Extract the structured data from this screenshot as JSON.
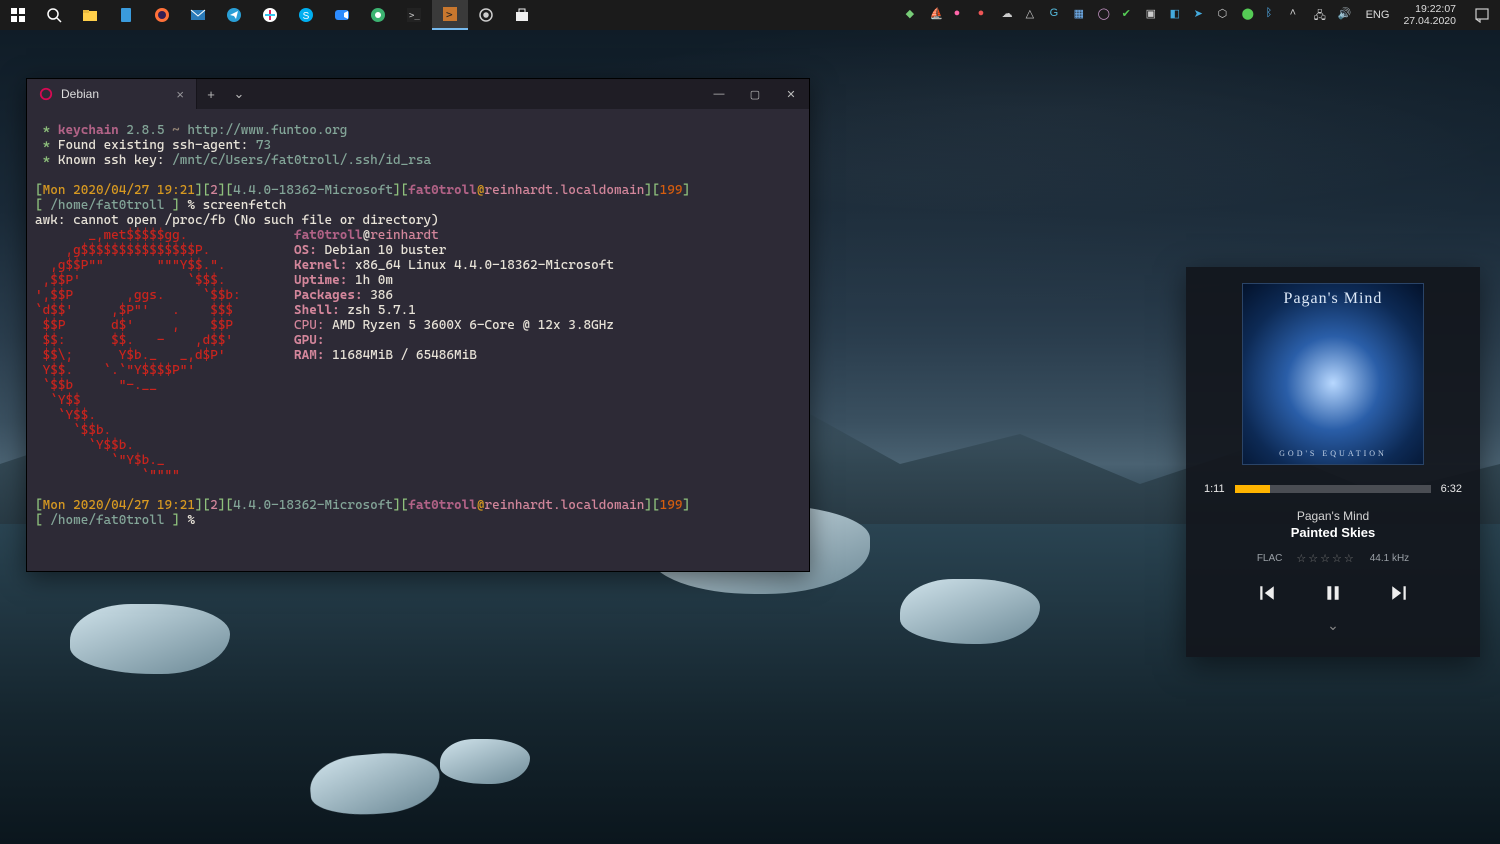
{
  "taskbar": {
    "lang": "ENG",
    "time": "19:22:07",
    "date": "27.04.2020"
  },
  "terminal": {
    "tab_title": "Debian",
    "keychain": {
      "name": "keychain",
      "ver": "2.8.5",
      "tilde": "~",
      "url": "http://www.funtoo.org",
      "found_line_a": "Found existing ssh-agent:",
      "found_pid": "73",
      "known_line_a": "Known ssh key:",
      "known_path": "/mnt/c/Users/fat0troll/.ssh/id_rsa"
    },
    "prompt": {
      "datetime": "Mon 2020/04/27 19:21",
      "jobs": "2",
      "kernel_tag": "4.4.0-18362-Microsoft",
      "user": "fat0troll",
      "at": "@",
      "host": "reinhardt.localdomain",
      "retcode": "199",
      "cwd": "/home/fat0troll",
      "percent": "%",
      "cmd": "screenfetch"
    },
    "awk_err": "awk: cannot open /proc/fb (No such file or directory)",
    "fetch": {
      "user": "fat0troll",
      "at": "@",
      "host": "reinhardt",
      "os_l": "OS:",
      "os_v": "Debian 10 buster",
      "kn_l": "Kernel:",
      "kn_v": "x86_64 Linux 4.4.0-18362-Microsoft",
      "up_l": "Uptime:",
      "up_v": "1h 0m",
      "pk_l": "Packages:",
      "pk_v": "386",
      "sh_l": "Shell:",
      "sh_v": "zsh 5.7.1",
      "cp_l": "CPU:",
      "cp_v": "AMD Ryzen 5 3600X 6-Core @ 12x 3.8GHz",
      "gp_l": "GPU:",
      "gp_v": "",
      "rm_l": "RAM:",
      "rm_v": "11684MiB / 65486MiB"
    },
    "art": {
      "l0": "       _,met$$$$$gg.           ",
      "l1": "    ,g$$$$$$$$$$$$$$$P.        ",
      "l2": "  ,g$$P\"\"       \"\"\"Y$$.\".      ",
      "l3": " ,$$P'              `$$$.      ",
      "l4": "',$$P       ,ggs.     `$$b:    ",
      "l5": "`d$$'     ,$P\"'   .    $$$     ",
      "l6": " $$P      d$'     ,    $$P     ",
      "l7": " $$:      $$.   -    ,d$$'     ",
      "l8": " $$\\;      Y$b._   _,d$P'      ",
      "l9": " Y$$.    `.`\"Y$$$$P\"'          ",
      "l10": " `$$b      \"-.__               ",
      "l11": "  `Y$$                          ",
      "l12": "   `Y$$.                        ",
      "l13": "     `$$b.                      ",
      "l14": "       `Y$$b.                   ",
      "l15": "          `\"Y$b._               ",
      "l16": "              `\"\"\"\"             "
    }
  },
  "music": {
    "band_on_cover": "Pagan's Mind",
    "cover_subtitle": "GOD'S EQUATION",
    "elapsed": "1:11",
    "total": "6:32",
    "progress_pct": 18,
    "artist": "Pagan's Mind",
    "title": "Painted Skies",
    "format": "FLAC",
    "stars": "☆☆☆☆☆",
    "sample": "44.1 kHz"
  }
}
